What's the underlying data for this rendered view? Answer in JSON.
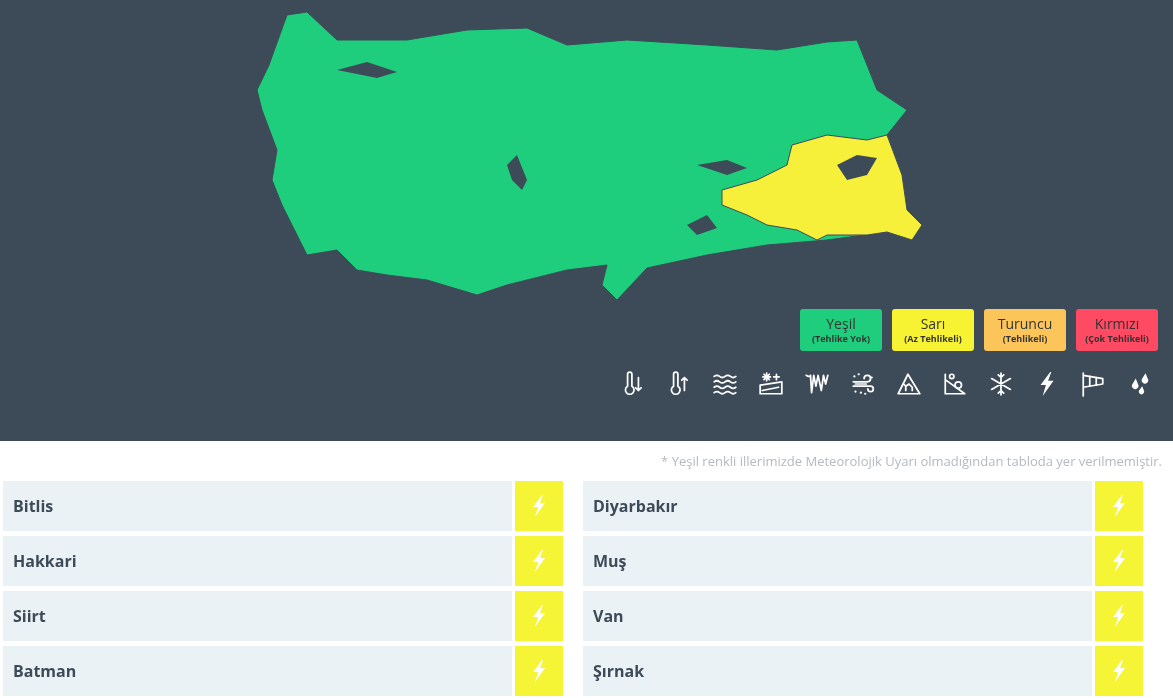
{
  "legend": [
    {
      "label": "Yeşil",
      "sublabel": "(Tehlike Yok)",
      "color": "#1fce7c"
    },
    {
      "label": "Sarı",
      "sublabel": "(Az Tehlikeli)",
      "color": "#f7f332"
    },
    {
      "label": "Turuncu",
      "sublabel": "(Tehlikeli)",
      "color": "#fcc55a"
    },
    {
      "label": "Kırmızı",
      "sublabel": "(Çok Tehlikeli)",
      "color": "#fe4a63"
    }
  ],
  "hazard_icons": [
    {
      "kind": "cold"
    },
    {
      "kind": "heat"
    },
    {
      "kind": "fog"
    },
    {
      "kind": "frost"
    },
    {
      "kind": "ice"
    },
    {
      "kind": "dust"
    },
    {
      "kind": "avalanche"
    },
    {
      "kind": "rockfall"
    },
    {
      "kind": "snow"
    },
    {
      "kind": "thunder"
    },
    {
      "kind": "wind"
    },
    {
      "kind": "rain"
    }
  ],
  "note": "* Yeşil renkli illerimizde Meteorolojik Uyarı olmadığından tabloda yer verilmemiştir.",
  "provinces": [
    {
      "name": "Bitlis",
      "kind": "thunder",
      "color": "#f5f535"
    },
    {
      "name": "Diyarbakır",
      "kind": "thunder",
      "color": "#f5f535"
    },
    {
      "name": "Hakkari",
      "kind": "thunder",
      "color": "#f5f535"
    },
    {
      "name": "Muş",
      "kind": "thunder",
      "color": "#f5f535"
    },
    {
      "name": "Siirt",
      "kind": "thunder",
      "color": "#f5f535"
    },
    {
      "name": "Van",
      "kind": "thunder",
      "color": "#f5f535"
    },
    {
      "name": "Batman",
      "kind": "thunder",
      "color": "#f5f535"
    },
    {
      "name": "Şırnak",
      "kind": "thunder",
      "color": "#f5f535"
    }
  ]
}
